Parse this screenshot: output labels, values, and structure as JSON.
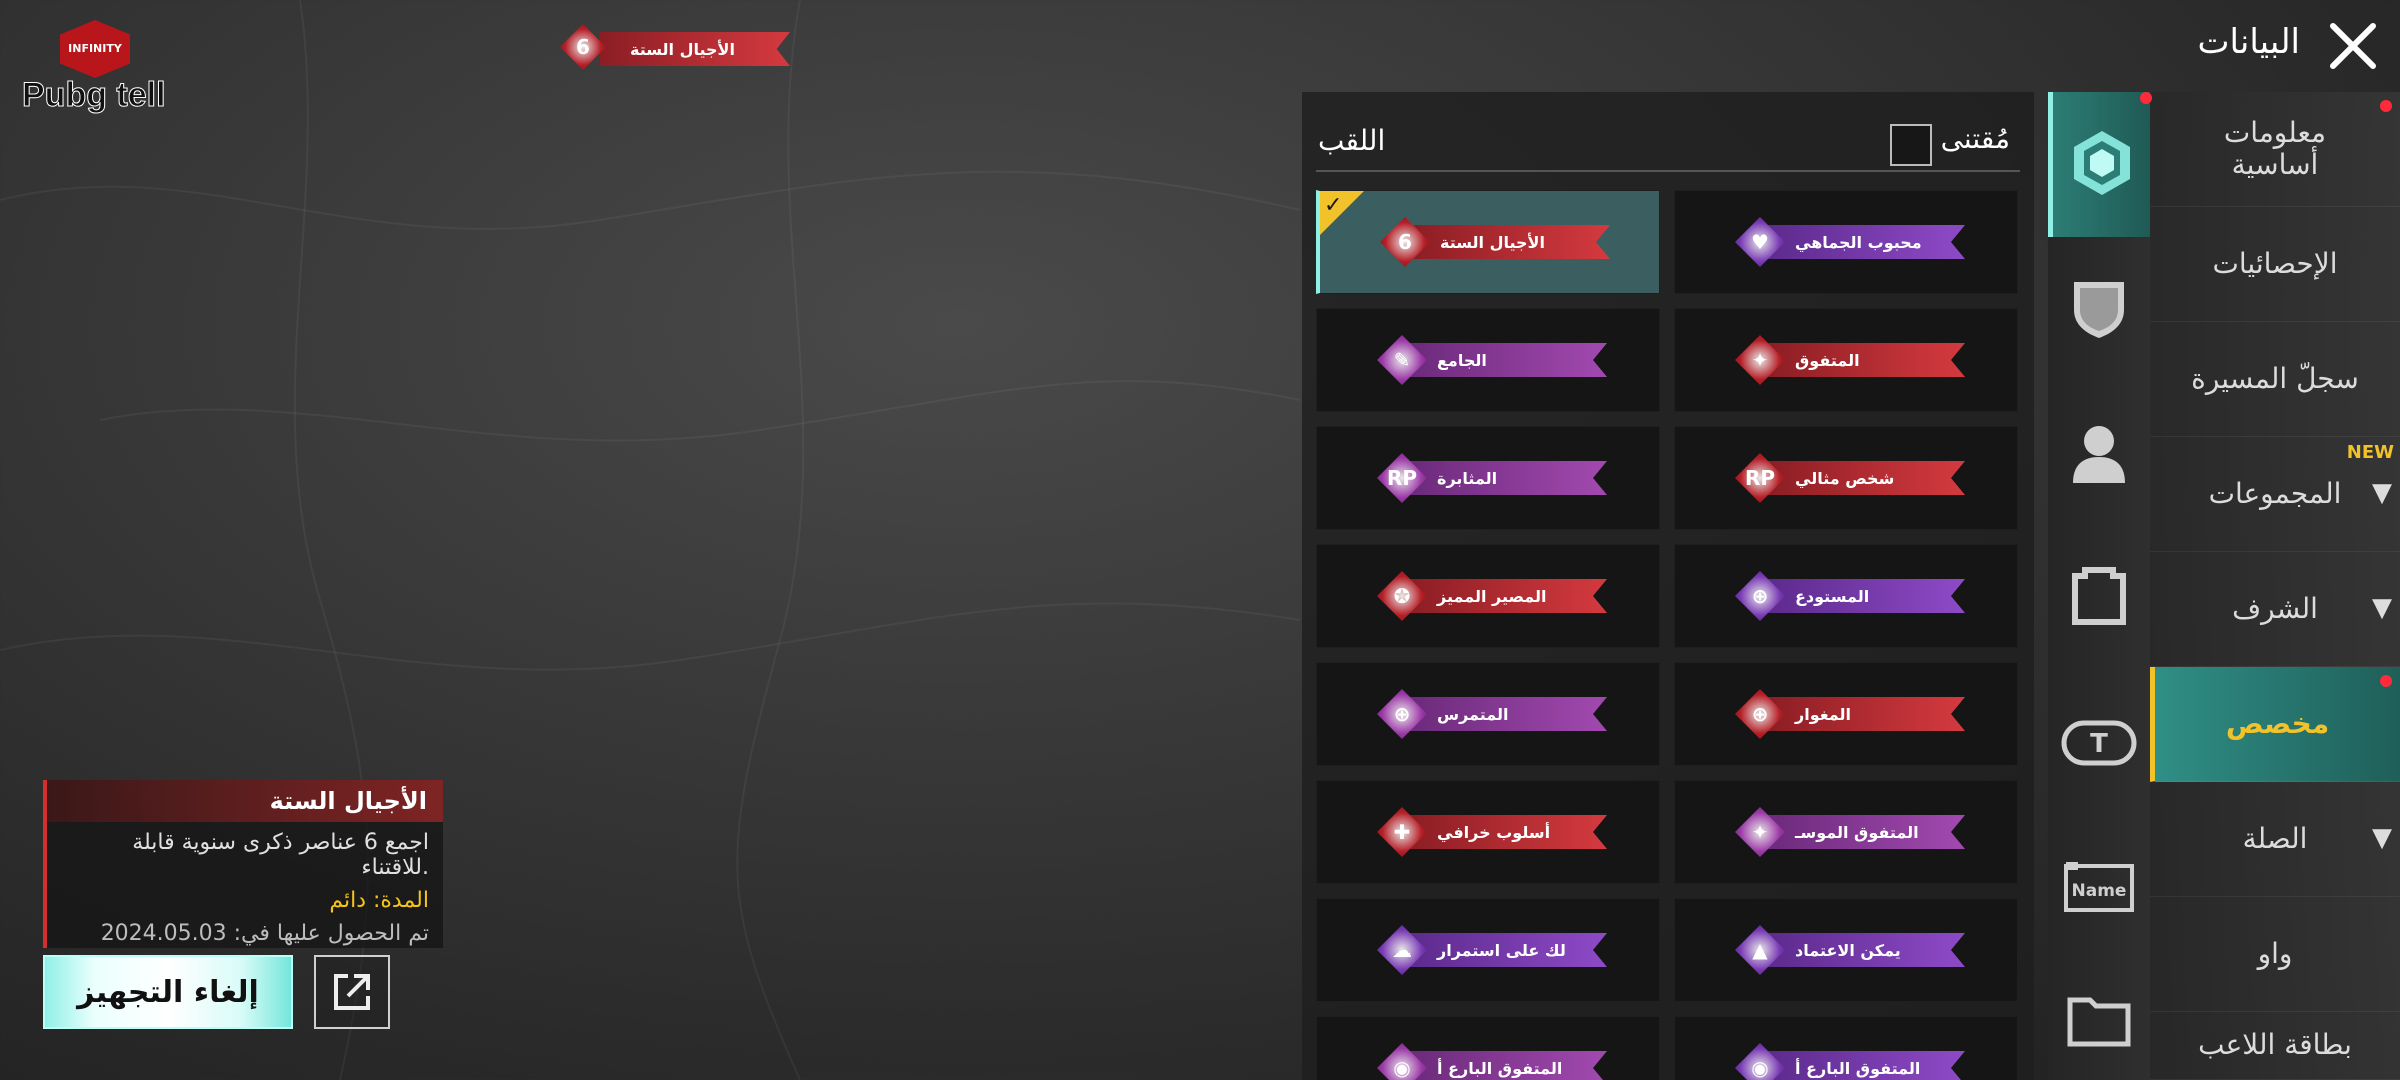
{
  "logo": {
    "badge_text": "INFINITY",
    "text": "Pubg tell"
  },
  "top_banner": {
    "label": "الأجيال الستة",
    "emblem": "6"
  },
  "header": {
    "title": "البيانات",
    "close_icon": "close-icon"
  },
  "right_nav": {
    "items": [
      {
        "label": "معلومات\nأساسية",
        "has_dot": true,
        "chevron": false,
        "active": false
      },
      {
        "label": "الإحصائيات",
        "has_dot": false,
        "chevron": false,
        "active": false
      },
      {
        "label": "سجلّ المسيرة",
        "has_dot": false,
        "chevron": false,
        "active": false
      },
      {
        "label": "المجموعات",
        "has_dot": false,
        "chevron": true,
        "active": false,
        "badge": "NEW"
      },
      {
        "label": "الشرف",
        "has_dot": false,
        "chevron": true,
        "active": false
      },
      {
        "label": "مخصص",
        "has_dot": true,
        "chevron": false,
        "active": true
      },
      {
        "label": "الصلة",
        "has_dot": false,
        "chevron": true,
        "active": false
      },
      {
        "label": "واو",
        "has_dot": false,
        "chevron": false,
        "active": false
      },
      {
        "label": "بطاقة اللاعب",
        "has_dot": false,
        "chevron": false,
        "active": false
      }
    ]
  },
  "icon_sidebar": {
    "items": [
      {
        "icon": "title-badge-icon",
        "active": true,
        "has_dot": true
      },
      {
        "icon": "shield-icon",
        "active": false
      },
      {
        "icon": "avatar-icon",
        "active": false
      },
      {
        "icon": "frame-icon",
        "active": false
      },
      {
        "icon": "tag-icon",
        "active": false
      },
      {
        "icon": "name-card-icon",
        "active": false
      },
      {
        "icon": "folder-icon",
        "active": false
      }
    ]
  },
  "titles_panel": {
    "title": "اللقب",
    "owned_label": "مُقتنى",
    "owned_checked": false,
    "cards": [
      {
        "label": "الأجيال الستة",
        "color": "red",
        "emblem": "6",
        "selected": true
      },
      {
        "label": "محبوب الجماهي",
        "color": "purple",
        "emblem": "♥",
        "selected": false
      },
      {
        "label": "الجامع",
        "color": "magenta",
        "emblem": "✎",
        "selected": false
      },
      {
        "label": "المتفوق",
        "color": "red",
        "emblem": "✦",
        "selected": false
      },
      {
        "label": "المثابرة",
        "color": "magenta",
        "emblem": "RP",
        "selected": false
      },
      {
        "label": "شخص مثالي",
        "color": "red",
        "emblem": "RP",
        "selected": false
      },
      {
        "label": "المصير المميز",
        "color": "red",
        "emblem": "✪",
        "selected": false
      },
      {
        "label": "المستودع",
        "color": "purple",
        "emblem": "⊕",
        "selected": false
      },
      {
        "label": "المتمرس",
        "color": "magenta",
        "emblem": "⊕",
        "selected": false
      },
      {
        "label": "المغوار",
        "color": "red",
        "emblem": "⊕",
        "selected": false
      },
      {
        "label": "أسلوب خرافي",
        "color": "red",
        "emblem": "✚",
        "selected": false
      },
      {
        "label": "المتفوق الموسـ",
        "color": "magenta",
        "emblem": "✦",
        "selected": false
      },
      {
        "label": "لك على استمرار",
        "color": "purple",
        "emblem": "☁",
        "selected": false
      },
      {
        "label": "يمكن الاعتماد",
        "color": "purple",
        "emblem": "▲",
        "selected": false
      },
      {
        "label": "المتفوق البارع أ",
        "color": "magenta",
        "emblem": "◉",
        "selected": false
      },
      {
        "label": "المتفوق البارع أ",
        "color": "purple",
        "emblem": "◉",
        "selected": false
      }
    ]
  },
  "info_box": {
    "title": "الأجيال الستة",
    "description": "اجمع 6 عناصر ذكرى سنوية قابلة للاقتناء.",
    "duration": "المدة: دائم",
    "obtained": "تم الحصول عليها في: 2024.05.03"
  },
  "buttons": {
    "unequip": "إلغاء التجهيز",
    "share_icon": "share-icon"
  },
  "colors": {
    "accent_teal": "#8ff0e6",
    "accent_gold": "#f2c22b",
    "alert_red": "#ff2a3a"
  }
}
